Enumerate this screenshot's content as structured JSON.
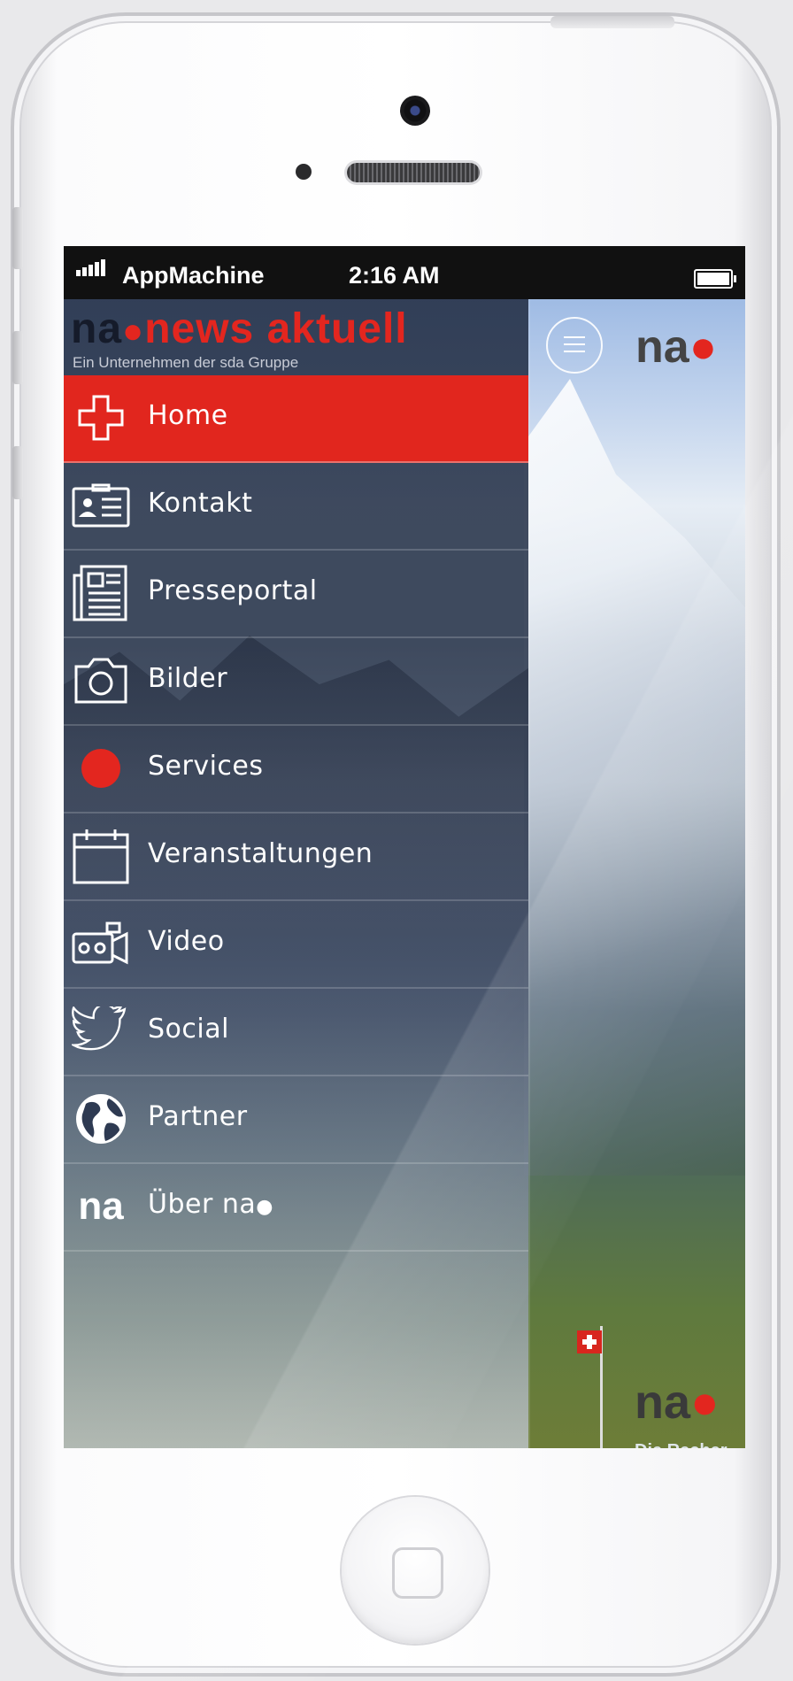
{
  "status_bar": {
    "carrier": "AppMachine",
    "time": "2:16 AM",
    "battery_level": 1.0
  },
  "drawer": {
    "brand_na": "na",
    "brand_name": "news aktuell",
    "brand_subtitle": "Ein Unternehmen der sda Gruppe",
    "items": [
      {
        "label": "Home",
        "icon": "plus-cross-icon",
        "active": true
      },
      {
        "label": "Kontakt",
        "icon": "contact-card-icon",
        "active": false
      },
      {
        "label": "Presseportal",
        "icon": "newspaper-icon",
        "active": false
      },
      {
        "label": "Bilder",
        "icon": "camera-icon",
        "active": false
      },
      {
        "label": "Services",
        "icon": "red-dot-icon",
        "active": false
      },
      {
        "label": "Veranstaltungen",
        "icon": "calendar-icon",
        "active": false
      },
      {
        "label": "Video",
        "icon": "video-camera-icon",
        "active": false
      },
      {
        "label": "Social",
        "icon": "twitter-bird-icon",
        "active": false
      },
      {
        "label": "Partner",
        "icon": "globe-icon",
        "active": false
      },
      {
        "label": "Über na",
        "icon": "na-logo-icon",
        "active": false
      }
    ],
    "last_icon_text": "na"
  },
  "main": {
    "logo_text": "na",
    "banner_logo_text": "na",
    "banner_subtitle": "Die Recher"
  },
  "colors": {
    "accent": "#e1261e",
    "drawer_bg": "#28344b",
    "logo_dark": "#444444"
  }
}
